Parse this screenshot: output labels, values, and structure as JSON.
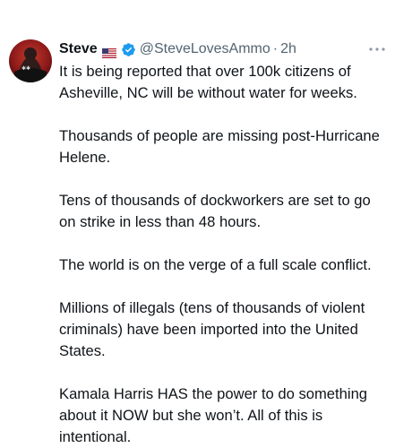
{
  "author": {
    "display_name": "Steve",
    "flag_icon": "us-flag-icon",
    "verified_icon": "verified-badge-icon",
    "verified_color": "#1d9bf0",
    "handle": "@SteveLovesAmmo",
    "separator": "·",
    "time": "2h"
  },
  "more_icon": "more-horizontal-icon",
  "tweet": {
    "paragraphs": [
      "It is being reported that over 100k citizens of Asheville, NC will be without water for weeks.",
      "Thousands of people are missing post-Hurricane Helene.",
      "Tens of thousands of dockworkers are set to go on strike in less than 48 hours.",
      "The world is on the verge of a full scale conflict.",
      "Millions of illegals (tens of thousands of violent criminals) have been imported into the United States.",
      "Kamala Harris HAS the power to do something about it NOW but she won’t. All of this is intentional."
    ]
  },
  "colors": {
    "text": "#0f1419",
    "secondary": "#536471",
    "background": "#ffffff"
  }
}
